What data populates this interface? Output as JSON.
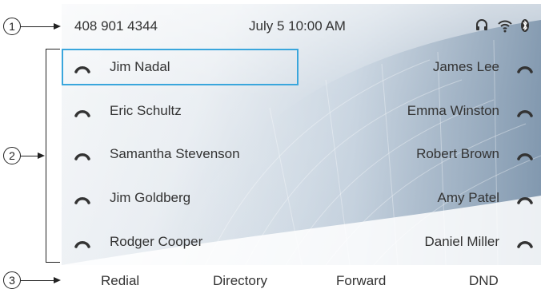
{
  "callouts": [
    "1",
    "2",
    "3"
  ],
  "status": {
    "phone_number": "408 901 4344",
    "datetime": "July 5 10:00 AM",
    "icons": [
      "headset-icon",
      "wifi-icon",
      "bluetooth-icon"
    ]
  },
  "line_keys": {
    "left": [
      "Jim Nadal",
      "Eric Schultz",
      "Samantha Stevenson",
      "Jim Goldberg",
      "Rodger Cooper"
    ],
    "right": [
      "James Lee",
      "Emma Winston",
      "Robert Brown",
      "Amy Patel",
      "Daniel Miller"
    ],
    "selected": "Jim Nadal"
  },
  "softkeys": [
    "Redial",
    "Directory",
    "Forward",
    "DND"
  ],
  "colors": {
    "selection": "#3aa6dc",
    "text": "#333333"
  }
}
